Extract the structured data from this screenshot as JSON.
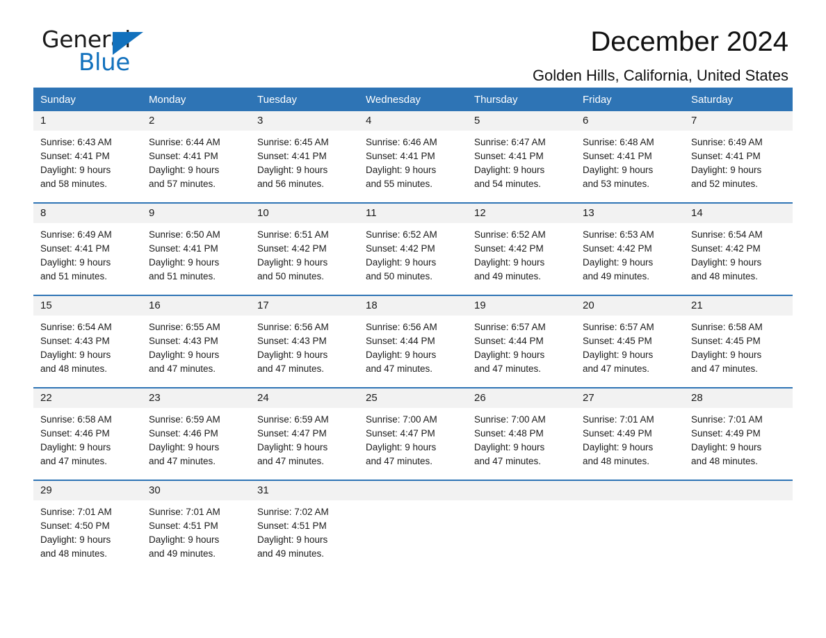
{
  "brand": {
    "name_primary": "General",
    "name_secondary": "Blue",
    "triangle_color": "#1271bd"
  },
  "header": {
    "title": "December 2024",
    "subtitle": "Golden Hills, California, United States"
  },
  "theme": {
    "header_blue": "#2e74b5",
    "daynum_band": "#f2f2f2",
    "text": "#1a1a1a"
  },
  "weekday_headers": [
    "Sunday",
    "Monday",
    "Tuesday",
    "Wednesday",
    "Thursday",
    "Friday",
    "Saturday"
  ],
  "weeks": [
    {
      "days": [
        {
          "num": "1",
          "sunrise": "Sunrise: 6:43 AM",
          "sunset": "Sunset: 4:41 PM",
          "daylight_1": "Daylight: 9 hours",
          "daylight_2": "and 58 minutes."
        },
        {
          "num": "2",
          "sunrise": "Sunrise: 6:44 AM",
          "sunset": "Sunset: 4:41 PM",
          "daylight_1": "Daylight: 9 hours",
          "daylight_2": "and 57 minutes."
        },
        {
          "num": "3",
          "sunrise": "Sunrise: 6:45 AM",
          "sunset": "Sunset: 4:41 PM",
          "daylight_1": "Daylight: 9 hours",
          "daylight_2": "and 56 minutes."
        },
        {
          "num": "4",
          "sunrise": "Sunrise: 6:46 AM",
          "sunset": "Sunset: 4:41 PM",
          "daylight_1": "Daylight: 9 hours",
          "daylight_2": "and 55 minutes."
        },
        {
          "num": "5",
          "sunrise": "Sunrise: 6:47 AM",
          "sunset": "Sunset: 4:41 PM",
          "daylight_1": "Daylight: 9 hours",
          "daylight_2": "and 54 minutes."
        },
        {
          "num": "6",
          "sunrise": "Sunrise: 6:48 AM",
          "sunset": "Sunset: 4:41 PM",
          "daylight_1": "Daylight: 9 hours",
          "daylight_2": "and 53 minutes."
        },
        {
          "num": "7",
          "sunrise": "Sunrise: 6:49 AM",
          "sunset": "Sunset: 4:41 PM",
          "daylight_1": "Daylight: 9 hours",
          "daylight_2": "and 52 minutes."
        }
      ]
    },
    {
      "days": [
        {
          "num": "8",
          "sunrise": "Sunrise: 6:49 AM",
          "sunset": "Sunset: 4:41 PM",
          "daylight_1": "Daylight: 9 hours",
          "daylight_2": "and 51 minutes."
        },
        {
          "num": "9",
          "sunrise": "Sunrise: 6:50 AM",
          "sunset": "Sunset: 4:41 PM",
          "daylight_1": "Daylight: 9 hours",
          "daylight_2": "and 51 minutes."
        },
        {
          "num": "10",
          "sunrise": "Sunrise: 6:51 AM",
          "sunset": "Sunset: 4:42 PM",
          "daylight_1": "Daylight: 9 hours",
          "daylight_2": "and 50 minutes."
        },
        {
          "num": "11",
          "sunrise": "Sunrise: 6:52 AM",
          "sunset": "Sunset: 4:42 PM",
          "daylight_1": "Daylight: 9 hours",
          "daylight_2": "and 50 minutes."
        },
        {
          "num": "12",
          "sunrise": "Sunrise: 6:52 AM",
          "sunset": "Sunset: 4:42 PM",
          "daylight_1": "Daylight: 9 hours",
          "daylight_2": "and 49 minutes."
        },
        {
          "num": "13",
          "sunrise": "Sunrise: 6:53 AM",
          "sunset": "Sunset: 4:42 PM",
          "daylight_1": "Daylight: 9 hours",
          "daylight_2": "and 49 minutes."
        },
        {
          "num": "14",
          "sunrise": "Sunrise: 6:54 AM",
          "sunset": "Sunset: 4:42 PM",
          "daylight_1": "Daylight: 9 hours",
          "daylight_2": "and 48 minutes."
        }
      ]
    },
    {
      "days": [
        {
          "num": "15",
          "sunrise": "Sunrise: 6:54 AM",
          "sunset": "Sunset: 4:43 PM",
          "daylight_1": "Daylight: 9 hours",
          "daylight_2": "and 48 minutes."
        },
        {
          "num": "16",
          "sunrise": "Sunrise: 6:55 AM",
          "sunset": "Sunset: 4:43 PM",
          "daylight_1": "Daylight: 9 hours",
          "daylight_2": "and 47 minutes."
        },
        {
          "num": "17",
          "sunrise": "Sunrise: 6:56 AM",
          "sunset": "Sunset: 4:43 PM",
          "daylight_1": "Daylight: 9 hours",
          "daylight_2": "and 47 minutes."
        },
        {
          "num": "18",
          "sunrise": "Sunrise: 6:56 AM",
          "sunset": "Sunset: 4:44 PM",
          "daylight_1": "Daylight: 9 hours",
          "daylight_2": "and 47 minutes."
        },
        {
          "num": "19",
          "sunrise": "Sunrise: 6:57 AM",
          "sunset": "Sunset: 4:44 PM",
          "daylight_1": "Daylight: 9 hours",
          "daylight_2": "and 47 minutes."
        },
        {
          "num": "20",
          "sunrise": "Sunrise: 6:57 AM",
          "sunset": "Sunset: 4:45 PM",
          "daylight_1": "Daylight: 9 hours",
          "daylight_2": "and 47 minutes."
        },
        {
          "num": "21",
          "sunrise": "Sunrise: 6:58 AM",
          "sunset": "Sunset: 4:45 PM",
          "daylight_1": "Daylight: 9 hours",
          "daylight_2": "and 47 minutes."
        }
      ]
    },
    {
      "days": [
        {
          "num": "22",
          "sunrise": "Sunrise: 6:58 AM",
          "sunset": "Sunset: 4:46 PM",
          "daylight_1": "Daylight: 9 hours",
          "daylight_2": "and 47 minutes."
        },
        {
          "num": "23",
          "sunrise": "Sunrise: 6:59 AM",
          "sunset": "Sunset: 4:46 PM",
          "daylight_1": "Daylight: 9 hours",
          "daylight_2": "and 47 minutes."
        },
        {
          "num": "24",
          "sunrise": "Sunrise: 6:59 AM",
          "sunset": "Sunset: 4:47 PM",
          "daylight_1": "Daylight: 9 hours",
          "daylight_2": "and 47 minutes."
        },
        {
          "num": "25",
          "sunrise": "Sunrise: 7:00 AM",
          "sunset": "Sunset: 4:47 PM",
          "daylight_1": "Daylight: 9 hours",
          "daylight_2": "and 47 minutes."
        },
        {
          "num": "26",
          "sunrise": "Sunrise: 7:00 AM",
          "sunset": "Sunset: 4:48 PM",
          "daylight_1": "Daylight: 9 hours",
          "daylight_2": "and 47 minutes."
        },
        {
          "num": "27",
          "sunrise": "Sunrise: 7:01 AM",
          "sunset": "Sunset: 4:49 PM",
          "daylight_1": "Daylight: 9 hours",
          "daylight_2": "and 48 minutes."
        },
        {
          "num": "28",
          "sunrise": "Sunrise: 7:01 AM",
          "sunset": "Sunset: 4:49 PM",
          "daylight_1": "Daylight: 9 hours",
          "daylight_2": "and 48 minutes."
        }
      ]
    },
    {
      "days": [
        {
          "num": "29",
          "sunrise": "Sunrise: 7:01 AM",
          "sunset": "Sunset: 4:50 PM",
          "daylight_1": "Daylight: 9 hours",
          "daylight_2": "and 48 minutes."
        },
        {
          "num": "30",
          "sunrise": "Sunrise: 7:01 AM",
          "sunset": "Sunset: 4:51 PM",
          "daylight_1": "Daylight: 9 hours",
          "daylight_2": "and 49 minutes."
        },
        {
          "num": "31",
          "sunrise": "Sunrise: 7:02 AM",
          "sunset": "Sunset: 4:51 PM",
          "daylight_1": "Daylight: 9 hours",
          "daylight_2": "and 49 minutes."
        },
        {
          "num": "",
          "sunrise": "",
          "sunset": "",
          "daylight_1": "",
          "daylight_2": ""
        },
        {
          "num": "",
          "sunrise": "",
          "sunset": "",
          "daylight_1": "",
          "daylight_2": ""
        },
        {
          "num": "",
          "sunrise": "",
          "sunset": "",
          "daylight_1": "",
          "daylight_2": ""
        },
        {
          "num": "",
          "sunrise": "",
          "sunset": "",
          "daylight_1": "",
          "daylight_2": ""
        }
      ]
    }
  ]
}
